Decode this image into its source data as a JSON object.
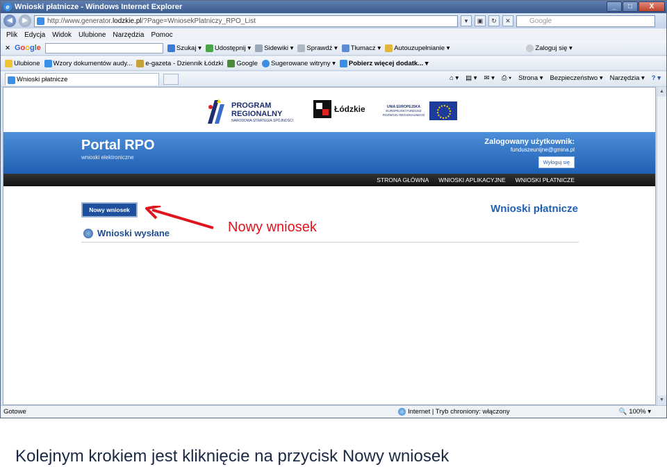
{
  "window": {
    "title": "Wnioski płatnicze - Windows Internet Explorer",
    "min": "_",
    "max": "□",
    "close": "X"
  },
  "address": {
    "url_prefix": "http://www.generator.",
    "url_domain": "lodzkie.pl",
    "url_suffix": "/?Page=WniosekPlatniczy_RPO_List",
    "search_placeholder": "Google"
  },
  "menubar": [
    "Plik",
    "Edycja",
    "Widok",
    "Ulubione",
    "Narzędzia",
    "Pomoc"
  ],
  "google_toolbar": {
    "logo": [
      "G",
      "o",
      "o",
      "g",
      "l",
      "e"
    ],
    "items": [
      "Szukaj ▾",
      "Udostępnij ▾",
      "Sidewiki ▾",
      "Sprawdź ▾",
      "Tłumacz ▾",
      "Autouzupełnianie ▾",
      "Zaloguj się ▾"
    ]
  },
  "favorites": {
    "label": "Ulubione",
    "items": [
      "Wzory dokumentów audy...",
      "e-gazeta - Dziennik Łódzki",
      "Google",
      "Sugerowane witryny ▾",
      "Pobierz więcej dodatk... ▾"
    ]
  },
  "tabs": {
    "active": "Wnioski płatnicze",
    "tools": [
      "Strona ▾",
      "Bezpieczeństwo ▾",
      "Narzędzia ▾"
    ]
  },
  "logos": {
    "program_line1": "PROGRAM",
    "program_line2": "REGIONALNY",
    "program_sub": "NARODOWA STRATEGIA SPÓJNOŚCI",
    "lodzkie": "Łódzkie",
    "eu_line1": "UNIA EUROPEJSKA",
    "eu_line2": "EUROPEJSKI FUNDUSZ",
    "eu_line3": "ROZWOJU REGIONALNEGO"
  },
  "banner": {
    "title": "Portal RPO",
    "subtitle": "wnioski elektroniczne",
    "user_label": "Zalogowany użytkownik:",
    "user_email": "funduszeunijne@gmina.pl",
    "logout": "Wyloguj się"
  },
  "nav": [
    "STRONA GŁÓWNA",
    "WNIOSKI APLIKACYJNE",
    "WNIOSKI PŁATNICZE"
  ],
  "main": {
    "new_button": "Nowy wniosek",
    "sent_label": "Wnioski wysłane",
    "section_title": "Wnioski płatnicze",
    "annotation": "Nowy wniosek",
    "annotation_color": "#e0141c"
  },
  "status": {
    "left": "Gotowe",
    "zone": "Internet | Tryb chroniony: włączony",
    "zoom": "100%"
  },
  "caption": "Kolejnym krokiem jest kliknięcie na przycisk Nowy wniosek"
}
